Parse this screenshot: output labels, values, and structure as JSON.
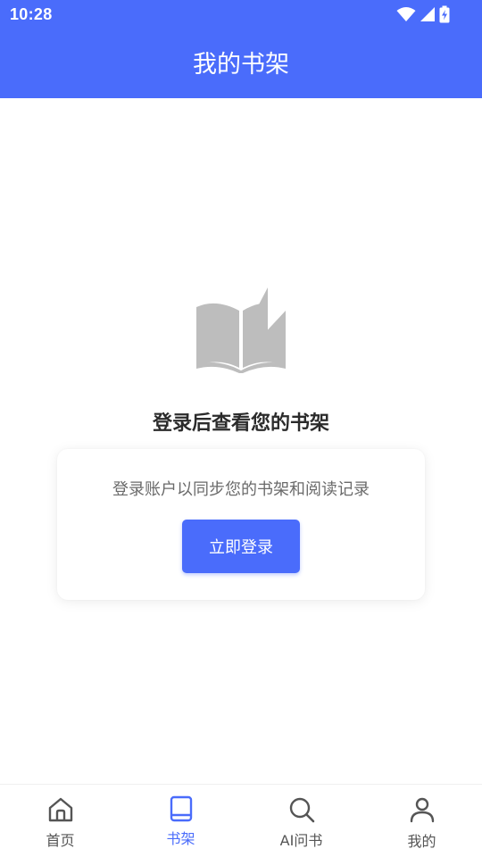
{
  "status_bar": {
    "time": "10:28",
    "icons": [
      "wifi-icon",
      "cell-signal-icon",
      "battery-charging-icon"
    ]
  },
  "header": {
    "title": "我的书架"
  },
  "empty_state": {
    "illustration": "open-book-icon",
    "heading": "登录后查看您的书架",
    "card": {
      "description": "登录账户以同步您的书架和阅读记录",
      "button_label": "立即登录"
    }
  },
  "bottom_nav": {
    "items": [
      {
        "label": "首页",
        "icon": "home-icon",
        "active": false
      },
      {
        "label": "书架",
        "icon": "book-icon",
        "active": true
      },
      {
        "label": "AI问书",
        "icon": "search-icon",
        "active": false
      },
      {
        "label": "我的",
        "icon": "user-icon",
        "active": false
      }
    ]
  },
  "colors": {
    "primary": "#4a6cfb",
    "inactive": "#555555",
    "illustration": "#bdbdbd",
    "heading": "#2b2b2b",
    "muted_text": "#6a6a6a"
  }
}
